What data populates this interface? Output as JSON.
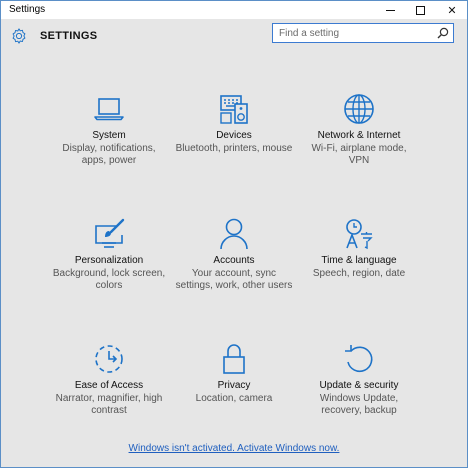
{
  "window": {
    "title": "Settings"
  },
  "header": {
    "title": "SETTINGS"
  },
  "search": {
    "placeholder": "Find a setting"
  },
  "colors": {
    "accent": "#1e73c8",
    "link": "#1f5fbf",
    "background": "#e6e6e6"
  },
  "tiles": [
    {
      "label": "System",
      "description": "Display, notifications, apps, power",
      "icon": "laptop-icon"
    },
    {
      "label": "Devices",
      "description": "Bluetooth, printers, mouse",
      "icon": "devices-icon"
    },
    {
      "label": "Network & Internet",
      "description": "Wi-Fi, airplane mode, VPN",
      "icon": "globe-icon"
    },
    {
      "label": "Personalization",
      "description": "Background, lock screen, colors",
      "icon": "paintbrush-icon"
    },
    {
      "label": "Accounts",
      "description": "Your account, sync settings, work, other users",
      "icon": "person-icon"
    },
    {
      "label": "Time & language",
      "description": "Speech, region, date",
      "icon": "time-language-icon"
    },
    {
      "label": "Ease of Access",
      "description": "Narrator, magnifier, high contrast",
      "icon": "ease-of-access-icon"
    },
    {
      "label": "Privacy",
      "description": "Location, camera",
      "icon": "lock-icon"
    },
    {
      "label": "Update & security",
      "description": "Windows Update, recovery, backup",
      "icon": "refresh-icon"
    }
  ],
  "footer": {
    "activate_link": "Windows isn't activated. Activate Windows now."
  }
}
